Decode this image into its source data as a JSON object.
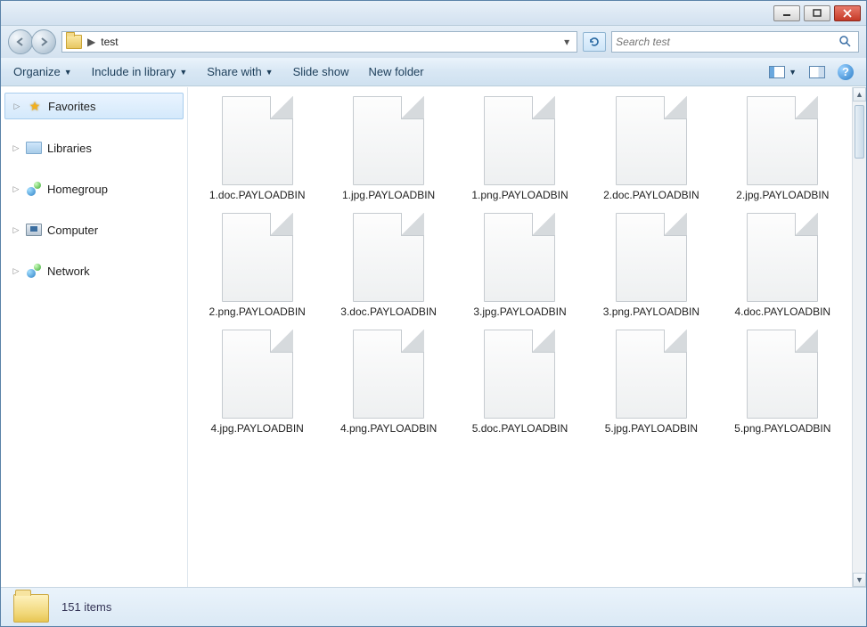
{
  "titlebar": {},
  "address": {
    "folder_name": "test",
    "search_placeholder": "Search test"
  },
  "toolbar": {
    "organize": "Organize",
    "include": "Include in library",
    "share": "Share with",
    "slideshow": "Slide show",
    "newfolder": "New folder"
  },
  "nav": {
    "items": [
      {
        "label": "Favorites",
        "icon": "star",
        "selected": true
      },
      {
        "label": "Libraries",
        "icon": "lib"
      },
      {
        "label": "Homegroup",
        "icon": "hg"
      },
      {
        "label": "Computer",
        "icon": "comp"
      },
      {
        "label": "Network",
        "icon": "net"
      }
    ]
  },
  "files": [
    {
      "name": "1.doc.PAYLOADBIN"
    },
    {
      "name": "1.jpg.PAYLOADBIN"
    },
    {
      "name": "1.png.PAYLOADBIN"
    },
    {
      "name": "2.doc.PAYLOADBIN"
    },
    {
      "name": "2.jpg.PAYLOADBIN"
    },
    {
      "name": "2.png.PAYLOADBIN"
    },
    {
      "name": "3.doc.PAYLOADBIN"
    },
    {
      "name": "3.jpg.PAYLOADBIN"
    },
    {
      "name": "3.png.PAYLOADBIN"
    },
    {
      "name": "4.doc.PAYLOADBIN"
    },
    {
      "name": "4.jpg.PAYLOADBIN"
    },
    {
      "name": "4.png.PAYLOADBIN"
    },
    {
      "name": "5.doc.PAYLOADBIN"
    },
    {
      "name": "5.jpg.PAYLOADBIN"
    },
    {
      "name": "5.png.PAYLOADBIN"
    }
  ],
  "status": {
    "count_label": "151 items"
  }
}
